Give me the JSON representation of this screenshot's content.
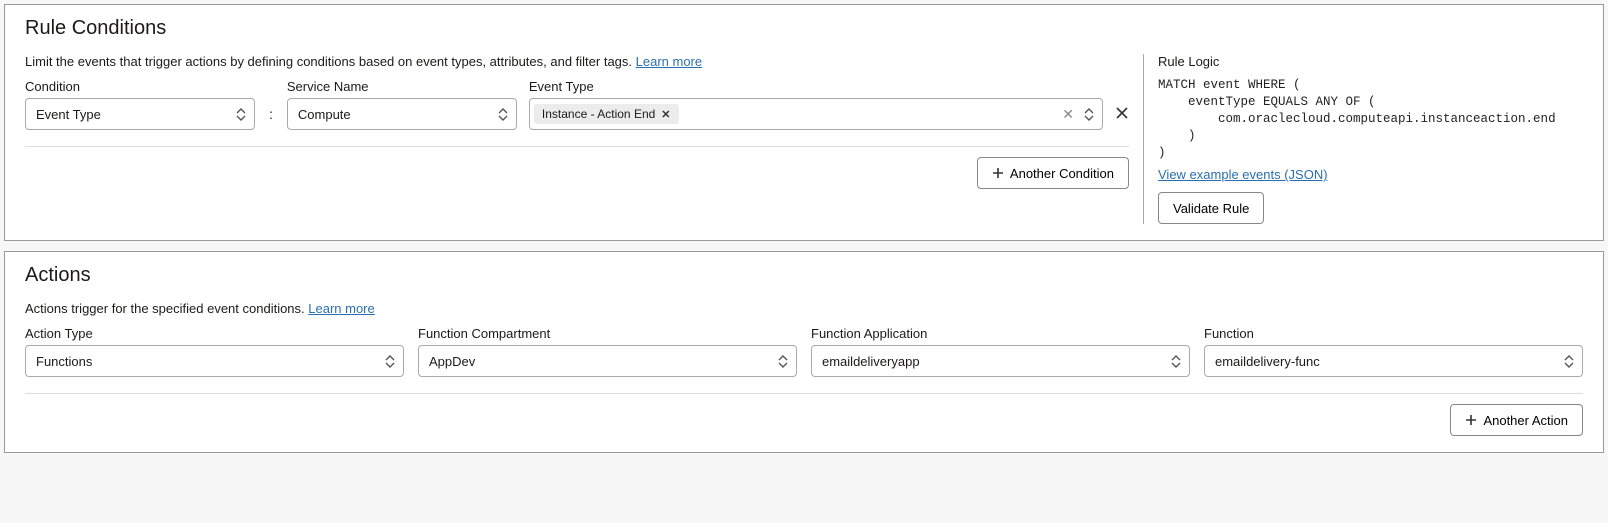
{
  "conditions": {
    "title": "Rule Conditions",
    "description_text": "Limit the events that trigger actions by defining conditions based on event types, attributes, and filter tags. ",
    "learn_more": "Learn more",
    "labels": {
      "condition": "Condition",
      "service_name": "Service Name",
      "event_type": "Event Type"
    },
    "row": {
      "condition_value": "Event Type",
      "service_value": "Compute",
      "event_tag": "Instance - Action End"
    },
    "another_condition": "Another Condition"
  },
  "logic": {
    "title": "Rule Logic",
    "code": "MATCH event WHERE (\n    eventType EQUALS ANY OF (\n        com.oraclecloud.computeapi.instanceaction.end\n    )\n)",
    "view_events": "View example events (JSON)",
    "validate": "Validate Rule"
  },
  "actions": {
    "title": "Actions",
    "description_text": "Actions trigger for the specified event conditions. ",
    "learn_more": "Learn more",
    "labels": {
      "action_type": "Action Type",
      "compartment": "Function Compartment",
      "application": "Function Application",
      "function": "Function"
    },
    "row": {
      "action_type": "Functions",
      "compartment": "AppDev",
      "application": "emaildeliveryapp",
      "function": "emaildelivery-func"
    },
    "another_action": "Another Action"
  }
}
